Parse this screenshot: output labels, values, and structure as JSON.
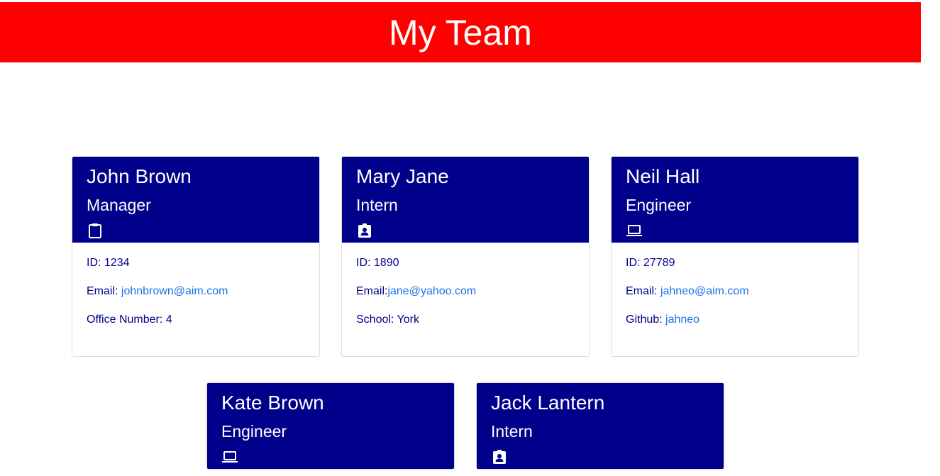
{
  "header": {
    "title": "My Team"
  },
  "employees": [
    {
      "name": "John Brown",
      "role": "Manager",
      "icon": "clipboard-icon",
      "id_label": "ID: 1234",
      "email_label": "Email: ",
      "email": "johnbrown@aim.com",
      "extra_label": "Office Number: 4",
      "extra_link": ""
    },
    {
      "name": "Mary Jane",
      "role": "Intern",
      "icon": "id-badge-icon",
      "id_label": "ID: 1890",
      "email_label": "Email:",
      "email": "jane@yahoo.com",
      "extra_label": "School: York",
      "extra_link": ""
    },
    {
      "name": "Neil Hall",
      "role": "Engineer",
      "icon": "laptop-icon",
      "id_label": "ID: 27789",
      "email_label": "Email: ",
      "email": "jahneo@aim.com",
      "extra_label": "Github: ",
      "extra_link": "jahneo"
    },
    {
      "name": "Kate Brown",
      "role": "Engineer",
      "icon": "laptop-icon"
    },
    {
      "name": "Jack Lantern",
      "role": "Intern",
      "icon": "id-badge-icon"
    }
  ],
  "colors": {
    "banner": "#ff0000",
    "card_header": "#00008b",
    "link": "#1a73e8"
  }
}
